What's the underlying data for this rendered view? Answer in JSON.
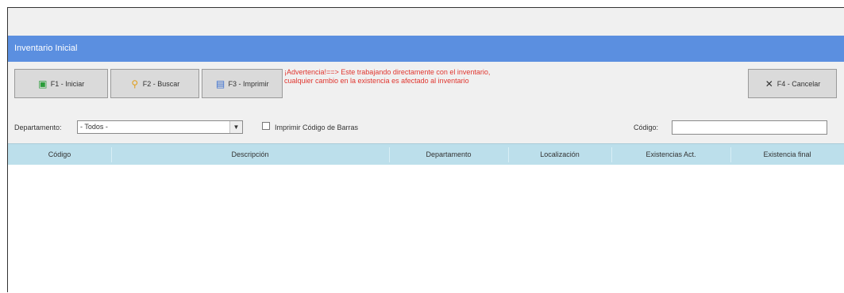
{
  "window": {
    "title": "Inventario Inicial"
  },
  "toolbar": {
    "new_label": "F1 - Iniciar",
    "search_label": "F2 - Buscar",
    "print_label": "F3 - Imprimir",
    "cancel_label": "F4 - Cancelar",
    "warning": "¡Advertencia!==> Este trabajando directamente con el inventario, cualquier cambio en la existencia es afectado al inventario"
  },
  "filters": {
    "department_label": "Departamento:",
    "department_value": "- Todos -",
    "barcode_label": "Imprimir Código de Barras",
    "barcode_checked": false,
    "code_label": "Código:",
    "code_value": ""
  },
  "table": {
    "columns": [
      "Código",
      "Descripción",
      "Departamento",
      "Localización",
      "Existencias Act.",
      "Existencia final"
    ],
    "rows": []
  },
  "colors": {
    "title_bar": "#5b8fe0",
    "header_bg": "#bcdfeb",
    "warning_text": "#e0362f"
  }
}
